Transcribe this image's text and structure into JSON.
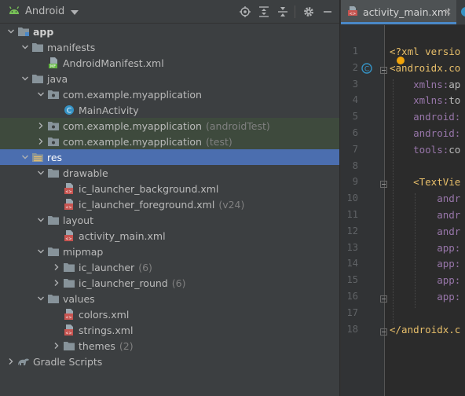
{
  "project_panel": {
    "view_selector": "Android",
    "toolbar_icons": [
      "locate-icon",
      "expand-all-icon",
      "collapse-all-icon",
      "settings-icon",
      "hide-icon"
    ]
  },
  "tree": [
    {
      "label": "app",
      "bold": true,
      "depth": 0,
      "arrow": "expanded",
      "icon": "module-folder-icon"
    },
    {
      "label": "manifests",
      "depth": 1,
      "arrow": "expanded",
      "icon": "folder-icon"
    },
    {
      "label": "AndroidManifest.xml",
      "depth": 2,
      "arrow": "none",
      "icon": "manifest-file-icon"
    },
    {
      "label": "java",
      "depth": 1,
      "arrow": "expanded",
      "icon": "folder-icon"
    },
    {
      "label": "com.example.myapplication",
      "depth": 2,
      "arrow": "expanded",
      "icon": "package-icon"
    },
    {
      "label": "MainActivity",
      "depth": 3,
      "arrow": "none",
      "icon": "class-icon"
    },
    {
      "label": "com.example.myapplication",
      "extra": "(androidTest)",
      "depth": 2,
      "arrow": "collapsed",
      "icon": "package-icon",
      "highlight": "green"
    },
    {
      "label": "com.example.myapplication",
      "extra": "(test)",
      "depth": 2,
      "arrow": "collapsed",
      "icon": "package-icon",
      "highlight": "green"
    },
    {
      "label": "res",
      "depth": 1,
      "arrow": "expanded",
      "icon": "res-folder-icon",
      "highlight": "selected"
    },
    {
      "label": "drawable",
      "depth": 2,
      "arrow": "expanded",
      "icon": "folder-icon"
    },
    {
      "label": "ic_launcher_background.xml",
      "depth": 3,
      "arrow": "none",
      "icon": "xml-file-icon"
    },
    {
      "label": "ic_launcher_foreground.xml",
      "extra": "(v24)",
      "depth": 3,
      "arrow": "none",
      "icon": "xml-file-icon"
    },
    {
      "label": "layout",
      "depth": 2,
      "arrow": "expanded",
      "icon": "folder-icon"
    },
    {
      "label": "activity_main.xml",
      "depth": 3,
      "arrow": "none",
      "icon": "xml-file-icon"
    },
    {
      "label": "mipmap",
      "depth": 2,
      "arrow": "expanded",
      "icon": "folder-icon"
    },
    {
      "label": "ic_launcher",
      "extra": "(6)",
      "depth": 3,
      "arrow": "collapsed",
      "icon": "folder-icon"
    },
    {
      "label": "ic_launcher_round",
      "extra": "(6)",
      "depth": 3,
      "arrow": "collapsed",
      "icon": "folder-icon"
    },
    {
      "label": "values",
      "depth": 2,
      "arrow": "expanded",
      "icon": "folder-icon"
    },
    {
      "label": "colors.xml",
      "depth": 3,
      "arrow": "none",
      "icon": "xml-file-icon"
    },
    {
      "label": "strings.xml",
      "depth": 3,
      "arrow": "none",
      "icon": "xml-file-icon"
    },
    {
      "label": "themes",
      "extra": "(2)",
      "depth": 3,
      "arrow": "collapsed",
      "icon": "folder-icon"
    },
    {
      "label": "Gradle Scripts",
      "depth": 0,
      "arrow": "collapsed",
      "icon": "gradle-icon"
    }
  ],
  "editor": {
    "active_tab": "activity_main.xml",
    "line_numbers": [
      "1",
      "2",
      "3",
      "4",
      "5",
      "6",
      "7",
      "8",
      "9",
      "10",
      "11",
      "12",
      "13",
      "14",
      "15",
      "16",
      "17",
      "18"
    ],
    "code_lines": [
      [
        {
          "t": "<?xml versio",
          "c": "c-pi"
        }
      ],
      [
        {
          "t": "<androidx.co",
          "c": "c-tag"
        }
      ],
      [
        {
          "t": "    xmlns:",
          "c": "c-ns"
        },
        {
          "t": "ap",
          "c": "c-attr"
        }
      ],
      [
        {
          "t": "    xmlns:",
          "c": "c-ns"
        },
        {
          "t": "to",
          "c": "c-attr"
        }
      ],
      [
        {
          "t": "    android:",
          "c": "c-ns"
        }
      ],
      [
        {
          "t": "    android:",
          "c": "c-ns"
        }
      ],
      [
        {
          "t": "    tools:",
          "c": "c-ns"
        },
        {
          "t": "co",
          "c": "c-attr"
        }
      ],
      [],
      [
        {
          "t": "    <TextVie",
          "c": "c-tag"
        }
      ],
      [
        {
          "t": "        andr",
          "c": "c-ns"
        }
      ],
      [
        {
          "t": "        andr",
          "c": "c-ns"
        }
      ],
      [
        {
          "t": "        andr",
          "c": "c-ns"
        }
      ],
      [
        {
          "t": "        app:",
          "c": "c-ns"
        }
      ],
      [
        {
          "t": "        app:",
          "c": "c-ns"
        }
      ],
      [
        {
          "t": "        app:",
          "c": "c-ns"
        }
      ],
      [
        {
          "t": "        app:",
          "c": "c-ns"
        }
      ],
      [],
      [
        {
          "t": "</androidx.c",
          "c": "c-tag"
        }
      ]
    ]
  },
  "colors": {
    "panel_bg": "#3c3f41",
    "selection": "#4b6eaf",
    "test_highlight": "#3e4a3d",
    "folder": "#87939a",
    "accent": "#4a88c7",
    "xml_tag": "#e8bf6a",
    "xml_ns": "#9876aa"
  }
}
